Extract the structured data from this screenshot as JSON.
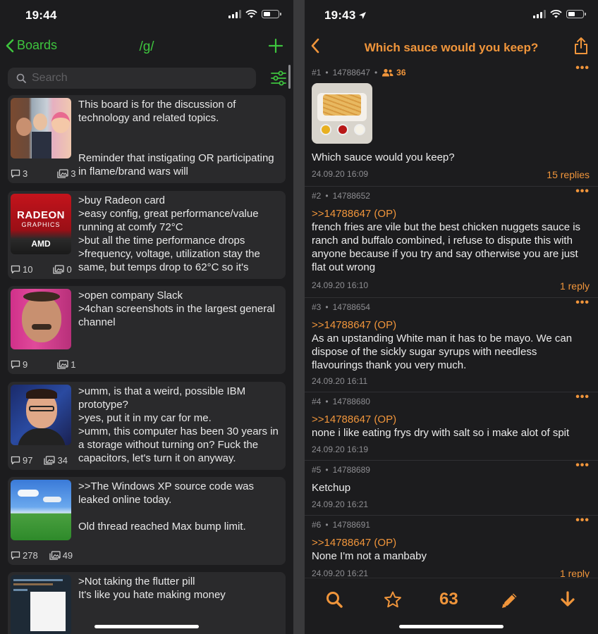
{
  "left": {
    "status": {
      "time": "19:44"
    },
    "nav": {
      "back_label": "Boards",
      "title": "/g/"
    },
    "search": {
      "placeholder": "Search"
    },
    "threads": [
      {
        "text": "This board is for the discussion of technology and related topics.\n\n\nReminder that instigating OR participating in flame/brand wars will",
        "replies": "3",
        "images": "3"
      },
      {
        "text": ">buy Radeon card\n>easy config, great performance/value running at comfy 72°C\n>but all the time performance drops\n>frequency, voltage, utilization stay the same, but temps drop to 62°C so it's",
        "replies": "10",
        "images": "0",
        "thumb_text": {
          "brand": "RADEON",
          "sub": "GRAPHICS",
          "maker": "AMD"
        }
      },
      {
        "text": ">open company Slack\n>4chan screenshots in the largest general channel",
        "replies": "9",
        "images": "1"
      },
      {
        "text": ">umm, is that a weird, possible IBM prototype?\n>yes, put it in my car for me.\n>umm, this computer has been 30 years in a storage without turning on? Fuck the capacitors, let's turn it on anyway.",
        "replies": "97",
        "images": "34"
      },
      {
        "text": ">>The Windows XP source code was leaked online today.\n\nOld thread reached Max bump limit.",
        "replies": "278",
        "images": "49"
      },
      {
        "text": ">Not taking the flutter pill\nIt's like you hate making money",
        "replies": "",
        "images": ""
      }
    ]
  },
  "right": {
    "status": {
      "time": "19:43"
    },
    "nav": {
      "title": "Which sauce would you keep?"
    },
    "posts": [
      {
        "num": "#1",
        "id": "14788647",
        "posters": "36",
        "quote": "",
        "body": "Which sauce would you keep?",
        "date": "24.09.20 16:09",
        "replies": "15 replies"
      },
      {
        "num": "#2",
        "id": "14788652",
        "quote": ">>14788647 (OP)",
        "body": "french fries are vile but the best chicken nuggets sauce is ranch and buffalo combined, i refuse to dispute this with anyone because if you try and say otherwise you are just flat out wrong",
        "date": "24.09.20 16:10",
        "replies": "1 reply"
      },
      {
        "num": "#3",
        "id": "14788654",
        "quote": ">>14788647 (OP)",
        "body": "As an upstanding White man it has to be mayo. We can dispose of the sickly sugar syrups with needless flavourings thank you very much.",
        "date": "24.09.20 16:11",
        "replies": ""
      },
      {
        "num": "#4",
        "id": "14788680",
        "quote": ">>14788647 (OP)",
        "body": "none i like eating frys dry with salt so i make alot of spit",
        "date": "24.09.20 16:19",
        "replies": ""
      },
      {
        "num": "#5",
        "id": "14788689",
        "quote": "",
        "body": "Ketchup",
        "date": "24.09.20 16:21",
        "replies": ""
      },
      {
        "num": "#6",
        "id": "14788691",
        "quote": ">>14788647 (OP)",
        "body": "None I'm not a manbaby",
        "date": "24.09.20 16:21",
        "replies": "1 reply"
      }
    ],
    "tabbar": {
      "post_count": "63"
    },
    "post_menu": "•••"
  },
  "colors": {
    "green_accent": "#3ec43e",
    "orange_accent": "#f0953b",
    "background": "#1c1c1e",
    "card": "#2a2a2c"
  },
  "icons": [
    "chevron-left-icon",
    "plus-icon",
    "search-icon",
    "filter-icon",
    "comment-icon",
    "images-icon",
    "people-icon",
    "share-icon",
    "star-icon",
    "pencil-icon",
    "arrow-down-icon",
    "wifi-icon",
    "battery-icon",
    "signal-icon",
    "location-icon"
  ]
}
